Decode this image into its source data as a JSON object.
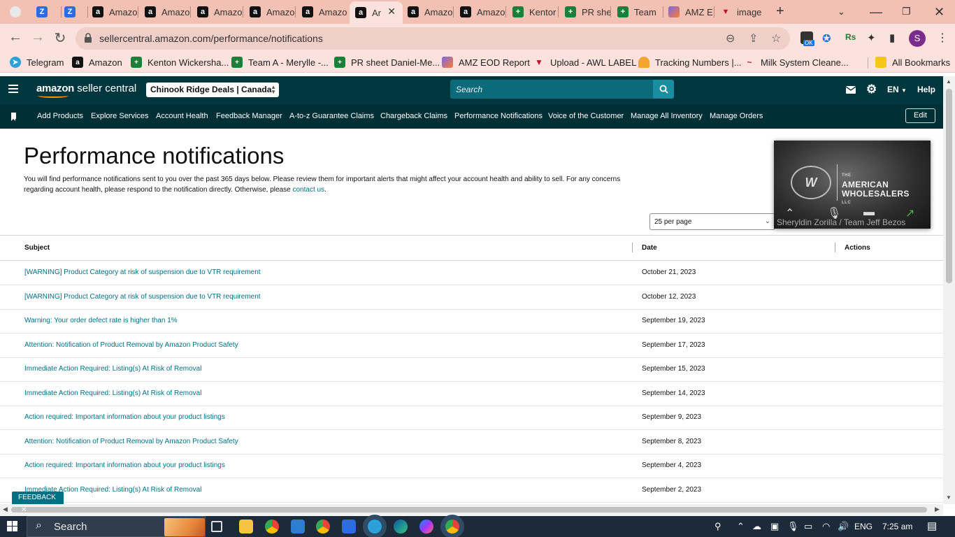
{
  "browser": {
    "tabs": [
      {
        "label": "",
        "icon": "chrome-gray-icon"
      },
      {
        "label": "",
        "icon": "zoom-icon"
      },
      {
        "label": "",
        "icon": "zoom-icon"
      },
      {
        "label": "Amazo",
        "icon": "amazon-icon"
      },
      {
        "label": "Amazo",
        "icon": "amazon-icon"
      },
      {
        "label": "Amazo",
        "icon": "amazon-icon"
      },
      {
        "label": "Amazo",
        "icon": "amazon-icon"
      },
      {
        "label": "Amazo",
        "icon": "amazon-icon"
      },
      {
        "label": "Ar",
        "icon": "amazon-icon",
        "active": true
      },
      {
        "label": "Amazo",
        "icon": "amazon-icon"
      },
      {
        "label": "Amazo",
        "icon": "amazon-icon"
      },
      {
        "label": "Kentor",
        "icon": "sheets-icon"
      },
      {
        "label": "PR she",
        "icon": "sheets-icon"
      },
      {
        "label": "Team ",
        "icon": "sheets-icon"
      },
      {
        "label": "AMZ E",
        "icon": "clickup-icon"
      },
      {
        "label": "image",
        "icon": "image-icon"
      }
    ],
    "url": "sellercentral.amazon.com/performance/notifications",
    "bookmarks": [
      {
        "label": "Telegram",
        "icon": "telegram-icon"
      },
      {
        "label": "Amazon",
        "icon": "amazon-icon"
      },
      {
        "label": "Kenton Wickersha...",
        "icon": "sheets-icon"
      },
      {
        "label": "Team A - Merylle -...",
        "icon": "sheets-icon"
      },
      {
        "label": "PR sheet Daniel-Me...",
        "icon": "sheets-icon"
      },
      {
        "label": "AMZ EOD Report",
        "icon": "clickup-icon"
      },
      {
        "label": "Upload - AWL LABEL",
        "icon": "upload-icon"
      },
      {
        "label": "Tracking Numbers |...",
        "icon": "taco-icon"
      },
      {
        "label": "Milk System Cleane...",
        "icon": "milk-icon"
      }
    ],
    "all_bookmarks": "All Bookmarks",
    "extension_badge": "OK",
    "profile_initial": "S"
  },
  "header": {
    "logo_amazon": "amazon",
    "logo_suffix": "seller central",
    "store": "Chinook Ridge Deals | Canada",
    "search_placeholder": "Search",
    "lang": "EN",
    "help": "Help"
  },
  "nav": {
    "items": [
      "Add Products",
      "Explore Services",
      "Account Health",
      "Feedback Manager",
      "A-to-z Guarantee Claims",
      "Chargeback Claims",
      "Performance Notifications",
      "Voice of the Customer",
      "Manage All Inventory",
      "Manage Orders"
    ],
    "edit": "Edit"
  },
  "main": {
    "title": "Performance notifications",
    "description": "You will find performance notifications sent to you over the past 365 days below. Please review them for important alerts that might affect your account health and ability to sell. For any concerns regarding account health, please respond to the notification directly. Otherwise, please",
    "contact_link": "contact us",
    "per_page": "25 per page",
    "columns": {
      "subject": "Subject",
      "date": "Date",
      "actions": "Actions"
    },
    "rows": [
      {
        "subject": "[WARNING] Product Category at risk of suspension due to VTR requirement",
        "date": "October 21, 2023"
      },
      {
        "subject": "[WARNING] Product Category at risk of suspension due to VTR requirement",
        "date": "October 12, 2023"
      },
      {
        "subject": "Warning: Your order defect rate is higher than 1%",
        "date": "September 19, 2023"
      },
      {
        "subject": "Attention: Notification of Product Removal by Amazon Product Safety",
        "date": "September 17, 2023"
      },
      {
        "subject": "Immediate Action Required: Listing(s) At Risk of Removal",
        "date": "September 15, 2023"
      },
      {
        "subject": "Immediate Action Required: Listing(s) At Risk of Removal",
        "date": "September 14, 2023"
      },
      {
        "subject": "Action required: Important information about your product listings",
        "date": "September 9, 2023"
      },
      {
        "subject": "Attention: Notification of Product Removal by Amazon Product Safety",
        "date": "September 8, 2023"
      },
      {
        "subject": "Action required: Important information about your product listings",
        "date": "September 4, 2023"
      },
      {
        "subject": "Immediate Action Required: Listing(s) At Risk of Removal",
        "date": "September 2, 2023"
      }
    ],
    "feedback": "FEEDBACK"
  },
  "video_overlay": {
    "brand_top": "THE",
    "brand_line1": "AMERICAN",
    "brand_line2": "WHOLESALERS",
    "brand_line3": "LLC",
    "participant": "Sheryldin Zorilla / Team Jeff Bezos"
  },
  "taskbar": {
    "search": "Search",
    "lang": "ENG",
    "time": "7:25 am"
  },
  "colors": {
    "header_bg": "#00363d",
    "nav_bg": "#002f36",
    "link": "#007185",
    "tab_strip": "#f3c0b4"
  }
}
